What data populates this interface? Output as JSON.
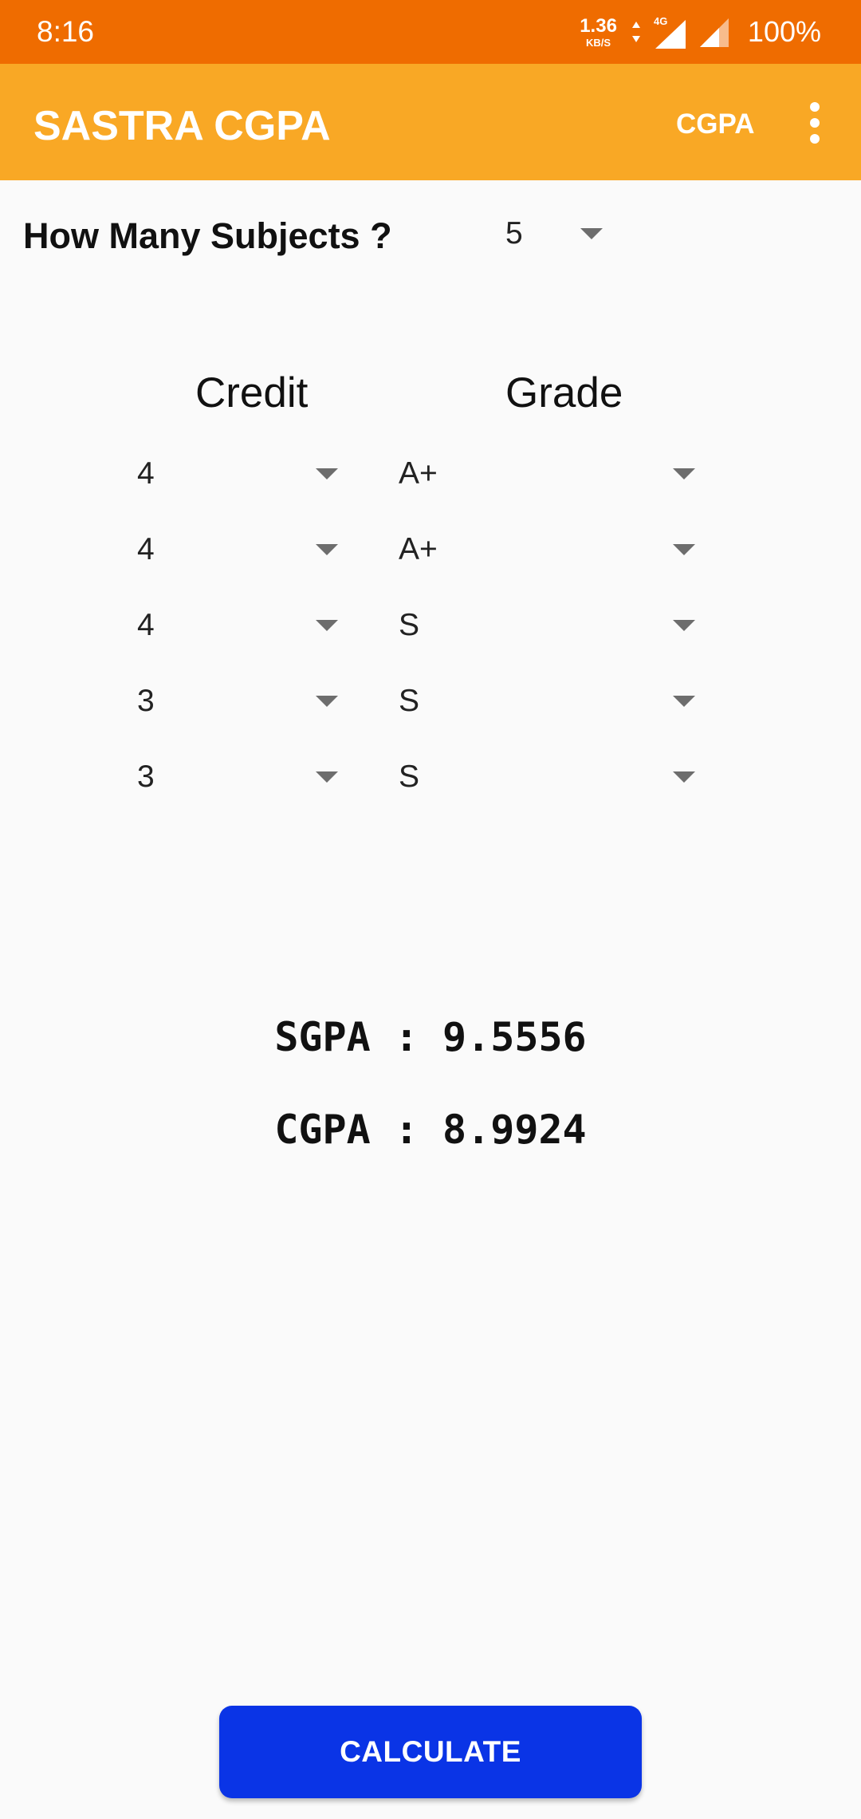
{
  "status_bar": {
    "time": "8:16",
    "net_speed": "1.36",
    "net_unit": "KB/S",
    "network_type": "4G",
    "battery": "100%"
  },
  "app_bar": {
    "title": "SASTRA CGPA",
    "action": "CGPA"
  },
  "subjects": {
    "label": "How Many Subjects ?",
    "value": "5"
  },
  "columns": {
    "credit": "Credit",
    "grade": "Grade"
  },
  "rows": [
    {
      "credit": "4",
      "grade": "A+"
    },
    {
      "credit": "4",
      "grade": "A+"
    },
    {
      "credit": "4",
      "grade": "S"
    },
    {
      "credit": "3",
      "grade": "S"
    },
    {
      "credit": "3",
      "grade": "S"
    }
  ],
  "results": {
    "sgpa": "SGPA : 9.5556",
    "cgpa": "CGPA : 8.9924"
  },
  "button": {
    "calculate": "CALCULATE"
  },
  "colors": {
    "status_bar": "#ef6c00",
    "app_bar": "#f9a825",
    "button": "#0a34e6",
    "background": "#fafafa"
  }
}
